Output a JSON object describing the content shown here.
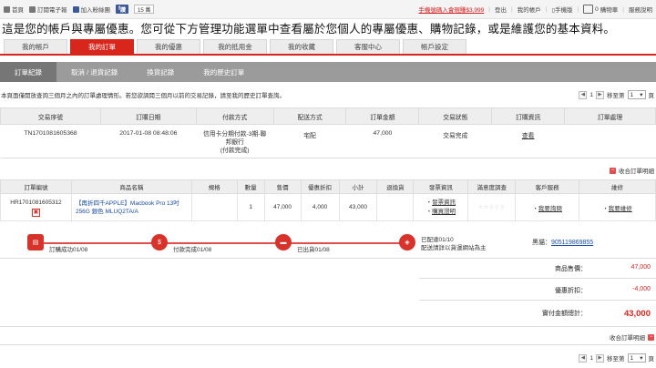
{
  "topbar": {
    "home": "首頁",
    "epaper": "訂閱電子報",
    "favorites": "加入粉絲團",
    "fb_like": "讚",
    "fb_count": "15 萬",
    "promo": "手機號碼入會現賺$3,999",
    "logout": "登出",
    "my_account": "我的帳戶",
    "mobile": "手機版",
    "cart_count": "0",
    "cart": "購物車",
    "service": "服務說明"
  },
  "intro": "這是您的帳戶與專屬優惠。您可從下方管理功能選單中查看屬於您個人的專屬優惠、購物記錄，或是維護您的基本資料。",
  "main_nav": {
    "tabs": [
      "我的帳戶",
      "我的訂單",
      "我的優惠",
      "我的抵用金",
      "我的收藏",
      "客服中心",
      "帳戶設定"
    ],
    "active": "我的訂單"
  },
  "sub_nav": {
    "tabs": [
      "訂單紀錄",
      "取消 / 退貨記錄",
      "換貨記錄",
      "我的歷史訂單"
    ],
    "active": "訂單紀錄"
  },
  "info": {
    "message": "本頁面僅開放查詢三個月之內的訂單處理情形。若您欲調閱三個月以前的交易記錄，請至我的歷史訂單查詢。",
    "page_current": "1",
    "goto_label": "移至第",
    "goto_value": "1",
    "page_suffix": "頁"
  },
  "order_table": {
    "headers": [
      "交易序號",
      "訂購日期",
      "付款方式",
      "配送方式",
      "訂單金額",
      "交易狀態",
      "訂購資訊",
      "訂單處理"
    ],
    "row": {
      "serial": "TN1701081605368",
      "date": "2017-01-08 08:48:06",
      "payment_line1": "信用卡分期付款-3期-聯",
      "payment_line2": "邦銀行",
      "payment_line3": "(付款完成)",
      "shipping": "宅配",
      "amount": "47,000",
      "status": "交易完成",
      "info_link": "查看",
      "process": ""
    }
  },
  "collapse_label": "收合訂單明細",
  "items_table": {
    "headers": [
      "訂單編號",
      "商品名稱",
      "規格",
      "數量",
      "售價",
      "優惠折扣",
      "小計",
      "退換貨",
      "發票資訊",
      "滿意度調查",
      "客戶服務",
      "維修"
    ],
    "row": {
      "order_no": "HR1701081605312",
      "product_line1": "【再折四千APPLE】Macbook Pro 13吋",
      "product_line2": "256G 銀色 MLUQ2TA/A",
      "spec": "",
      "qty": "1",
      "price": "47,000",
      "discount": "4,000",
      "subtotal": "43,000",
      "returns": "",
      "invoice1": "發票資訊",
      "invoice2": "購買證明",
      "rating": "☆☆☆☆☆",
      "service": "我要詢問",
      "repair": "我要維修"
    }
  },
  "progress": {
    "step1": "訂購成功01/08",
    "step2": "付款完成01/08",
    "step3": "已出貨01/08",
    "step4a": "已配達01/10",
    "step4b": "配送請詳以貨運網站為主",
    "tracking_label": "黑貓：",
    "tracking_no": "905119869855"
  },
  "totals": {
    "price_label": "商品售價：",
    "price_value": "47,000",
    "discount_label": "優惠折扣：",
    "discount_value": "-4,000",
    "total_label": "實付金額總計：",
    "total_value": "43,000"
  },
  "colors": {
    "accent": "#d8261d",
    "subnav": "#9b9b9b",
    "link": "#1a4ea8"
  }
}
